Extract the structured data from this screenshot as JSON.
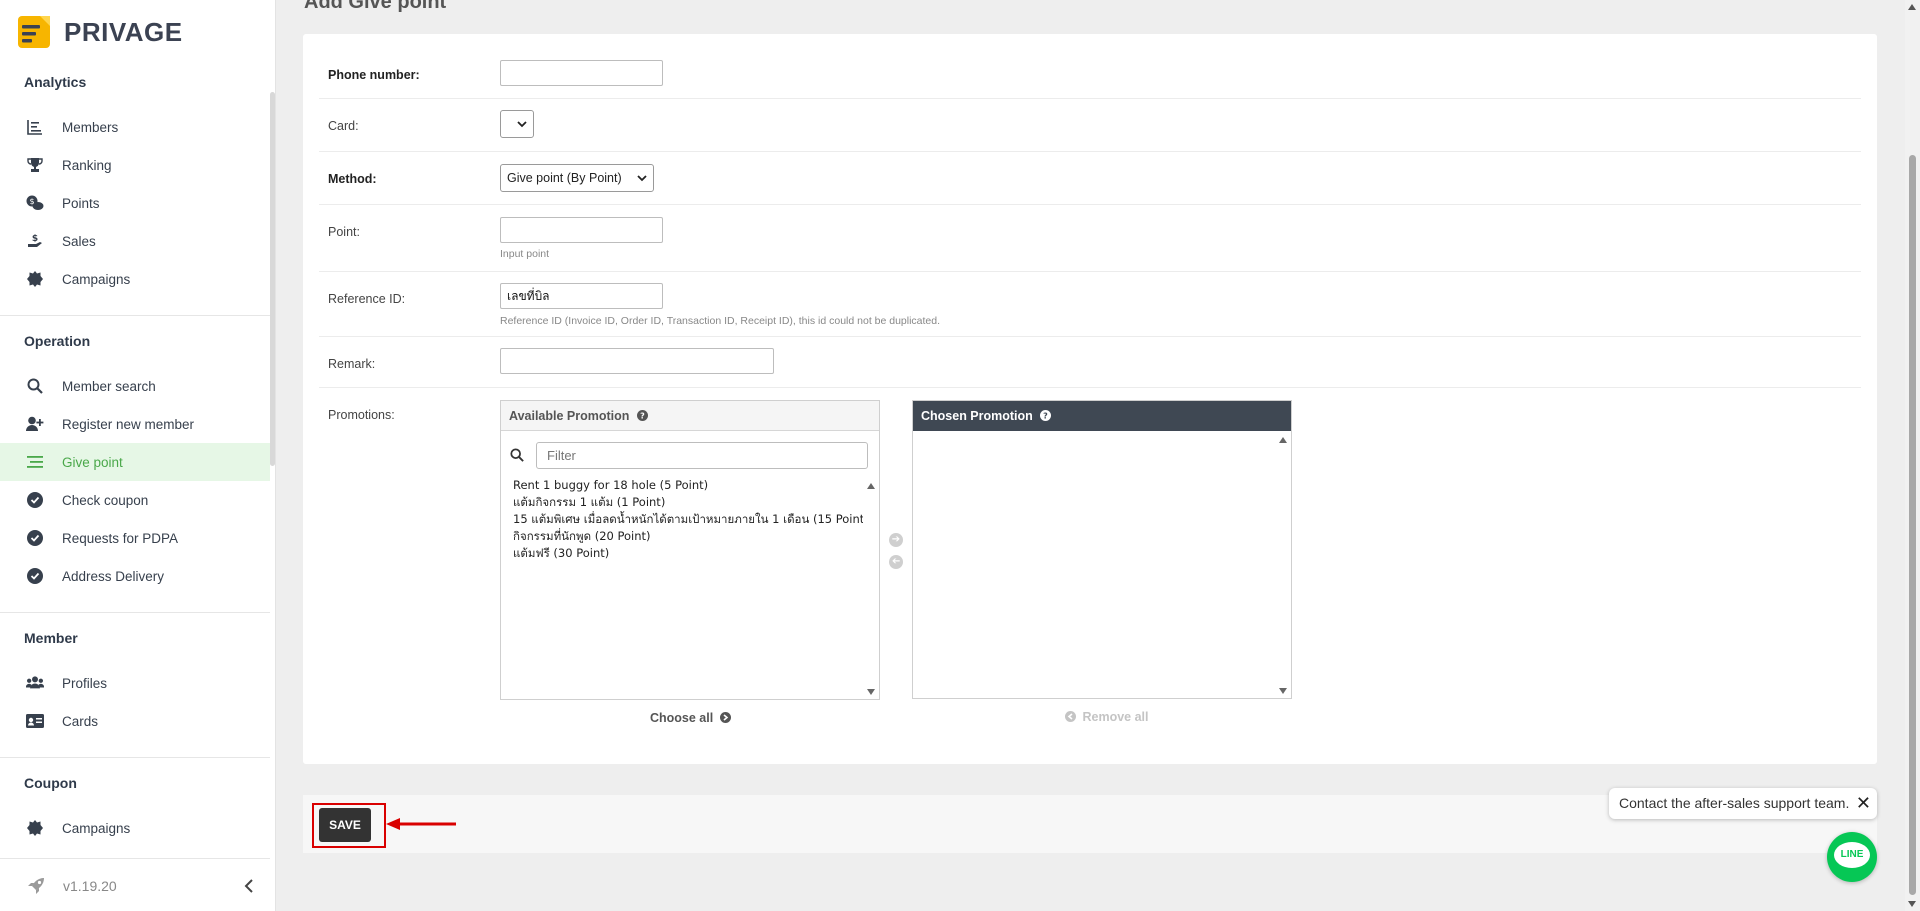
{
  "brand": {
    "name": "PRIVAGE"
  },
  "sidebar": {
    "sections": [
      {
        "title": "Analytics",
        "items": [
          {
            "label": "Members",
            "icon": "bar-list-icon"
          },
          {
            "label": "Ranking",
            "icon": "trophy-icon"
          },
          {
            "label": "Points",
            "icon": "coins-icon"
          },
          {
            "label": "Sales",
            "icon": "hand-money-icon"
          },
          {
            "label": "Campaigns",
            "icon": "badge-icon"
          }
        ]
      },
      {
        "title": "Operation",
        "items": [
          {
            "label": "Member search",
            "icon": "search-icon"
          },
          {
            "label": "Register new member",
            "icon": "user-plus-icon"
          },
          {
            "label": "Give point",
            "icon": "menu-lines-icon",
            "active": true
          },
          {
            "label": "Check coupon",
            "icon": "check-circle-icon"
          },
          {
            "label": "Requests for PDPA",
            "icon": "check-circle-icon"
          },
          {
            "label": "Address Delivery",
            "icon": "check-circle-icon"
          }
        ]
      },
      {
        "title": "Member",
        "items": [
          {
            "label": "Profiles",
            "icon": "users-icon"
          },
          {
            "label": "Cards",
            "icon": "id-card-icon"
          }
        ]
      },
      {
        "title": "Coupon",
        "items": [
          {
            "label": "Campaigns",
            "icon": "badge-icon"
          }
        ]
      }
    ],
    "version": "v1.19.20"
  },
  "page": {
    "title": "Add Give point"
  },
  "form": {
    "phone_label": "Phone number:",
    "phone_value": "",
    "card_label": "Card:",
    "card_value": "",
    "method_label": "Method:",
    "method_value": "Give point (By Point)",
    "point_label": "Point:",
    "point_value": "",
    "point_hint": "Input point",
    "reference_label": "Reference ID:",
    "reference_value": "เลขที่บิล",
    "reference_hint": "Reference ID (Invoice ID, Order ID, Transaction ID, Receipt ID), this id could not be duplicated.",
    "remark_label": "Remark:",
    "remark_value": "",
    "promotions_label": "Promotions:"
  },
  "promotions": {
    "available_title": "Available Promotion",
    "chosen_title": "Chosen Promotion",
    "filter_placeholder": "Filter",
    "available_options": [
      "Rent 1 buggy for 18 hole (5 Point)",
      "แต้มกิจกรรม 1 แต้ม (1 Point)",
      "15 แต้มพิเศษ เมื่อลดน้ำหนักได้ตามเป้าหมายภายใน 1 เดือน (15 Point)",
      "กิจกรรมที่นักพูด (20 Point)",
      "แต้มฟรี (30 Point)"
    ],
    "chosen_options": [],
    "choose_all": "Choose all",
    "remove_all": "Remove all"
  },
  "actions": {
    "save_label": "SAVE"
  },
  "support": {
    "message": "Contact the after-sales support team.",
    "line_label": "LINE"
  },
  "colors": {
    "active_bg": "#e6f7e6",
    "active_text": "#4aa84a",
    "dark_header": "#3f4853",
    "highlight": "#d90000",
    "line_green": "#06c755"
  }
}
